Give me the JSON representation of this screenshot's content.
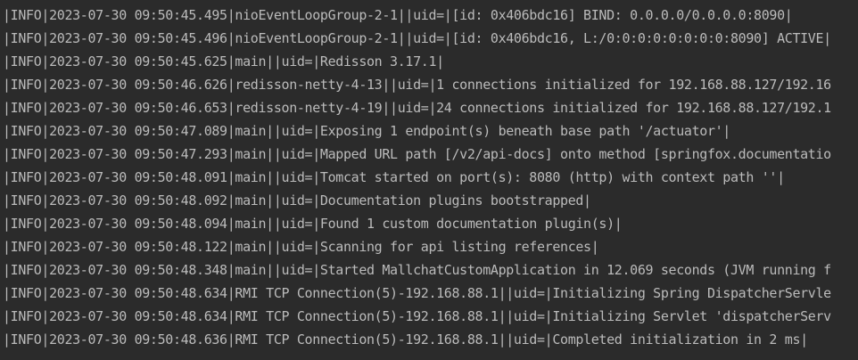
{
  "console": {
    "lines": [
      "|INFO|2023-07-30 09:50:45.495|nioEventLoopGroup-2-1||uid=|[id: 0x406bdc16] BIND: 0.0.0.0/0.0.0.0:8090|",
      "|INFO|2023-07-30 09:50:45.496|nioEventLoopGroup-2-1||uid=|[id: 0x406bdc16, L:/0:0:0:0:0:0:0:0:8090] ACTIVE|",
      "|INFO|2023-07-30 09:50:45.625|main||uid=|Redisson 3.17.1|",
      "|INFO|2023-07-30 09:50:46.626|redisson-netty-4-13||uid=|1 connections initialized for 192.168.88.127/192.16",
      "|INFO|2023-07-30 09:50:46.653|redisson-netty-4-19||uid=|24 connections initialized for 192.168.88.127/192.1",
      "|INFO|2023-07-30 09:50:47.089|main||uid=|Exposing 1 endpoint(s) beneath base path '/actuator'|",
      "|INFO|2023-07-30 09:50:47.293|main||uid=|Mapped URL path [/v2/api-docs] onto method [springfox.documentatio",
      "|INFO|2023-07-30 09:50:48.091|main||uid=|Tomcat started on port(s): 8080 (http) with context path ''|",
      "|INFO|2023-07-30 09:50:48.092|main||uid=|Documentation plugins bootstrapped|",
      "|INFO|2023-07-30 09:50:48.094|main||uid=|Found 1 custom documentation plugin(s)|",
      "|INFO|2023-07-30 09:50:48.122|main||uid=|Scanning for api listing references|",
      "|INFO|2023-07-30 09:50:48.348|main||uid=|Started MallchatCustomApplication in 12.069 seconds (JVM running f",
      "|INFO|2023-07-30 09:50:48.634|RMI TCP Connection(5)-192.168.88.1||uid=|Initializing Spring DispatcherServle",
      "|INFO|2023-07-30 09:50:48.634|RMI TCP Connection(5)-192.168.88.1||uid=|Initializing Servlet 'dispatcherServ",
      "|INFO|2023-07-30 09:50:48.636|RMI TCP Connection(5)-192.168.88.1||uid=|Completed initialization in 2 ms|"
    ]
  }
}
